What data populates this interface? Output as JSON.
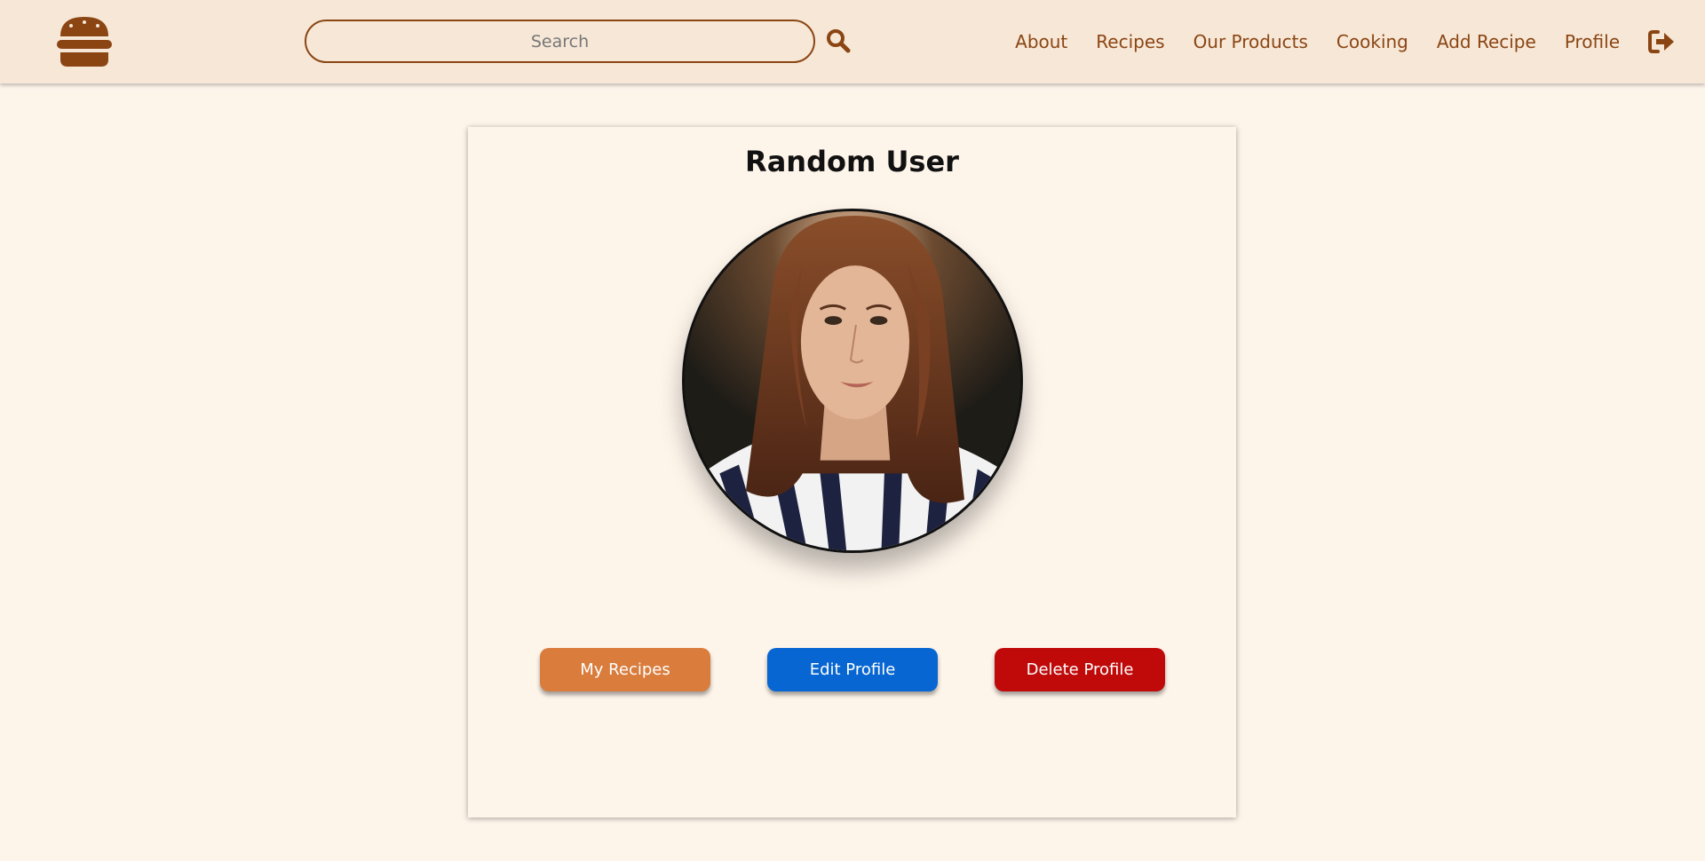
{
  "header": {
    "logo_icon": "burger-icon",
    "search": {
      "placeholder": "Search",
      "value": "",
      "icon": "search-icon"
    },
    "nav": [
      {
        "label": "About"
      },
      {
        "label": "Recipes"
      },
      {
        "label": "Our Products"
      },
      {
        "label": "Cooking"
      },
      {
        "label": "Add Recipe"
      },
      {
        "label": "Profile"
      }
    ],
    "logout_icon": "sign-out-icon"
  },
  "profile": {
    "name": "Random User",
    "avatar_icon": "profile-photo",
    "buttons": {
      "my_recipes": "My Recipes",
      "edit_profile": "Edit Profile",
      "delete_profile": "Delete Profile"
    }
  },
  "colors": {
    "page_bg": "#fdf4ea",
    "header_bg": "#f6e7d7",
    "brand_brown": "#8b4513",
    "my_recipes_btn": "#d97c3c",
    "edit_profile_btn": "#0766d1",
    "delete_profile_btn": "#c00a0a"
  }
}
